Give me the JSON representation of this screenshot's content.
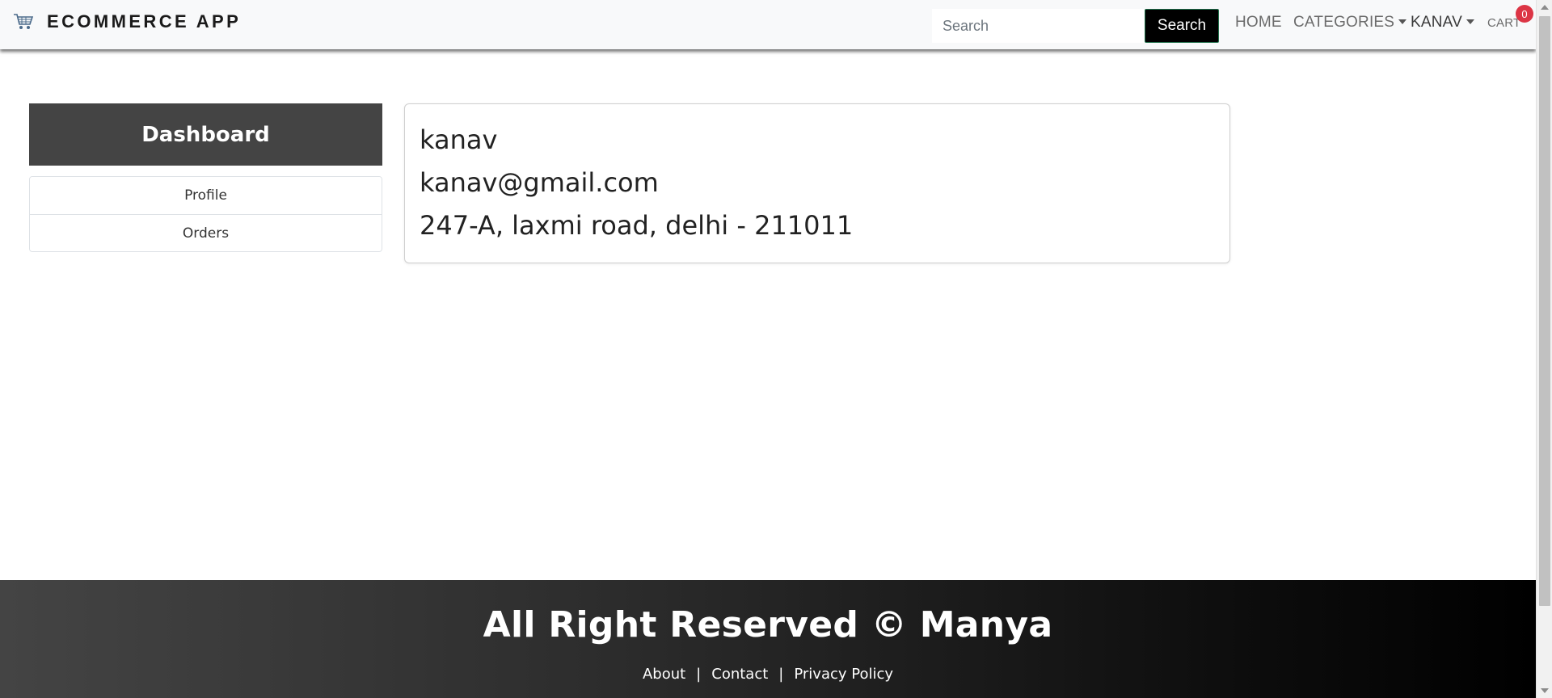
{
  "navbar": {
    "brand": "ECOMMERCE APP",
    "brand_icon": "shopping-cart-icon",
    "search": {
      "placeholder": "Search",
      "button_label": "Search"
    },
    "links": {
      "home": "HOME",
      "categories": "CATEGORIES",
      "user": "KANAV",
      "cart": "CART"
    },
    "cart_count": "0"
  },
  "sidebar": {
    "title": "Dashboard",
    "items": [
      {
        "label": "Profile"
      },
      {
        "label": "Orders"
      }
    ]
  },
  "profile": {
    "name": "kanav",
    "email": "kanav@gmail.com",
    "address": "247-A, laxmi road, delhi - 211011"
  },
  "footer": {
    "title": "All Right Reserved © Manya",
    "links": [
      "About",
      "Contact",
      "Privacy Policy"
    ],
    "separator": "|"
  },
  "colors": {
    "navbar_bg": "#f8f9fa",
    "dashboard_header_bg": "#444444",
    "search_button_bg": "#000000",
    "badge_bg": "#dc3545",
    "footer_gradient_start": "#444444",
    "footer_gradient_end": "#000000"
  }
}
